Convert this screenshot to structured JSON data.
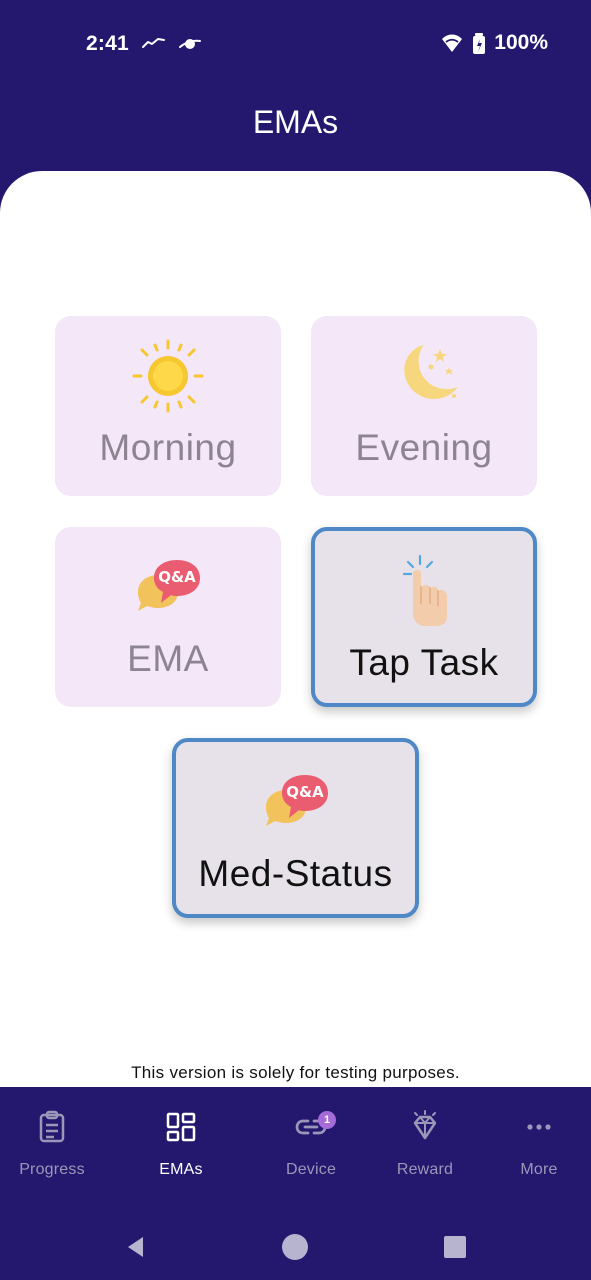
{
  "status_bar": {
    "time": "2:41",
    "battery": "100%",
    "icons": [
      "polar-icon",
      "planet-icon",
      "wifi-icon",
      "battery-charging-icon"
    ]
  },
  "header": {
    "title": "EMAs"
  },
  "ema_cards": [
    {
      "label": "Morning",
      "icon": "sun-icon",
      "state": "disabled"
    },
    {
      "label": "Evening",
      "icon": "moon-stars-icon",
      "state": "disabled"
    },
    {
      "label": "EMA",
      "icon": "qa-chat-icon",
      "state": "disabled"
    },
    {
      "label": "Tap Task",
      "icon": "tap-finger-icon",
      "state": "active"
    },
    {
      "label": "Med-Status",
      "icon": "qa-chat-icon",
      "state": "active"
    }
  ],
  "qa_icon_text": "Q&A",
  "footer": {
    "note": "This version is solely for testing purposes."
  },
  "bottom_nav": {
    "items": [
      {
        "label": "Progress",
        "icon": "clipboard-icon",
        "active": false
      },
      {
        "label": "EMAs",
        "icon": "grid-icon",
        "active": true
      },
      {
        "label": "Device",
        "icon": "link-icon",
        "active": false,
        "badge": "1"
      },
      {
        "label": "Reward",
        "icon": "diamond-icon",
        "active": false
      },
      {
        "label": "More",
        "icon": "more-dots-icon",
        "active": false
      }
    ]
  },
  "android_nav": {
    "icons": [
      "back-icon",
      "home-icon",
      "recents-icon"
    ]
  },
  "colors": {
    "primary_bg": "#24186e",
    "card_bg": "#f3e8f8",
    "card_active_bg": "#e7e2e9",
    "card_active_border": "#4e88c7",
    "inactive_text": "#8d8491",
    "nav_inactive": "#9b97b8",
    "badge": "#a56bd8",
    "sun": "#f6c72f",
    "qa_bubble": "#ea5c70",
    "qa_bubble_back": "#f2c25b",
    "moon": "#f6d77d",
    "finger": "#f3ccab",
    "tap_lines": "#56a7dd"
  }
}
